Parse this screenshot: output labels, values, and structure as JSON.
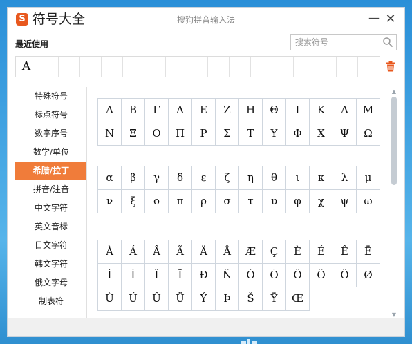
{
  "window": {
    "app_title": "符号大全",
    "logo_text": "S",
    "subtitle": "搜狗拼音输入法",
    "minimize_label": "—",
    "close_label": "✕"
  },
  "recent": {
    "title": "最近使用",
    "items": [
      "A",
      "",
      "",
      "",
      "",
      "",
      "",
      "",
      "",
      "",
      "",
      "",
      "",
      "",
      "",
      "",
      ""
    ]
  },
  "search": {
    "placeholder": "搜索符号",
    "value": ""
  },
  "categories": [
    {
      "label": "特殊符号",
      "active": false
    },
    {
      "label": "标点符号",
      "active": false
    },
    {
      "label": "数字序号",
      "active": false
    },
    {
      "label": "数学/单位",
      "active": false
    },
    {
      "label": "希腊/拉丁",
      "active": true
    },
    {
      "label": "拼音/注音",
      "active": false
    },
    {
      "label": "中文字符",
      "active": false
    },
    {
      "label": "英文音标",
      "active": false
    },
    {
      "label": "日文字符",
      "active": false
    },
    {
      "label": "韩文字符",
      "active": false
    },
    {
      "label": "俄文字母",
      "active": false
    },
    {
      "label": "制表符",
      "active": false
    }
  ],
  "groups": [
    {
      "name": "greek-upper",
      "symbols": [
        "Α",
        "Β",
        "Γ",
        "Δ",
        "Ε",
        "Ζ",
        "Η",
        "Θ",
        "Ι",
        "Κ",
        "Λ",
        "Μ",
        "Ν",
        "Ξ",
        "Ο",
        "Π",
        "Ρ",
        "Σ",
        "Τ",
        "Υ",
        "Φ",
        "Χ",
        "Ψ",
        "Ω"
      ]
    },
    {
      "name": "greek-lower",
      "symbols": [
        "α",
        "β",
        "γ",
        "δ",
        "ε",
        "ζ",
        "η",
        "θ",
        "ι",
        "κ",
        "λ",
        "μ",
        "ν",
        "ξ",
        "ο",
        "π",
        "ρ",
        "σ",
        "τ",
        "υ",
        "φ",
        "χ",
        "ψ",
        "ω"
      ]
    },
    {
      "name": "latin-extended",
      "symbols": [
        "À",
        "Á",
        "Â",
        "Ã",
        "Ä",
        "Å",
        "Æ",
        "Ç",
        "È",
        "É",
        "Ê",
        "Ë",
        "Ì",
        "Í",
        "Î",
        "Ï",
        "Ð",
        "Ñ",
        "Ò",
        "Ó",
        "Ô",
        "Õ",
        "Ö",
        "Ø",
        "Ù",
        "Ú",
        "Û",
        "Ü",
        "Ý",
        "Þ",
        "Š",
        "Ÿ",
        "Œ"
      ]
    }
  ],
  "icons": {
    "search": "search-icon",
    "trash": "trash-icon"
  },
  "colors": {
    "accent": "#f07c3a",
    "logo": "#e8581e",
    "trash": "#e8581e"
  }
}
